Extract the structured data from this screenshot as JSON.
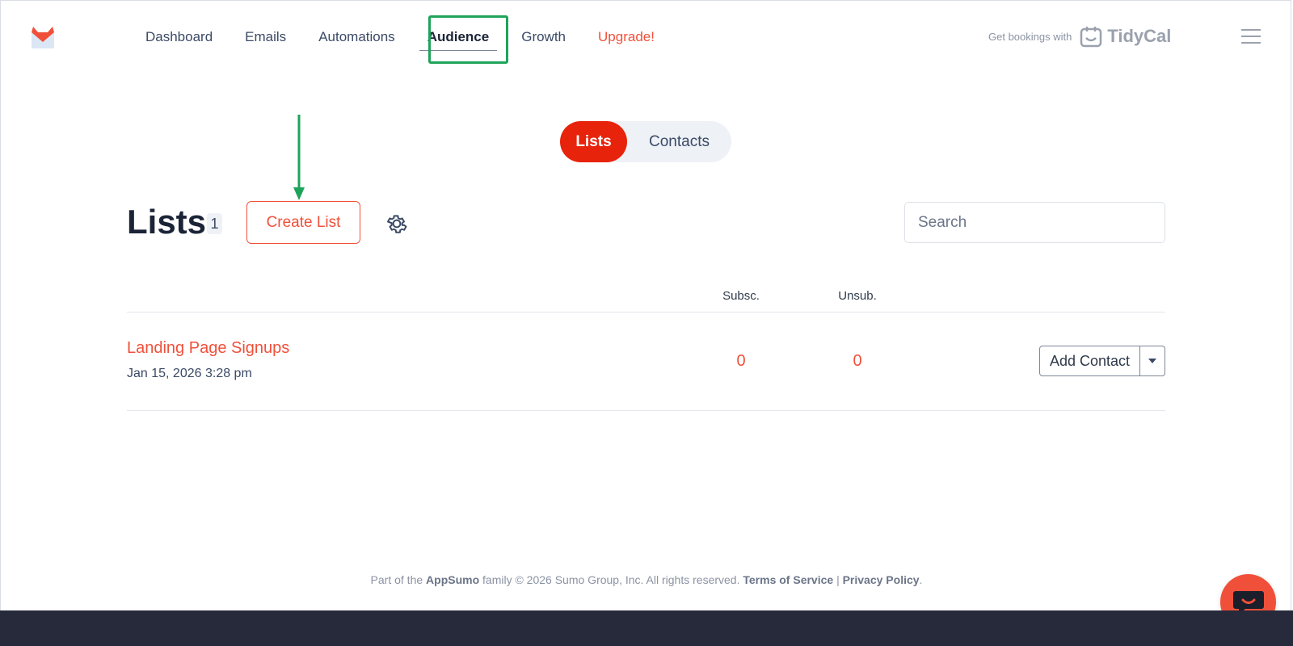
{
  "nav": {
    "items": [
      {
        "label": "Dashboard"
      },
      {
        "label": "Emails"
      },
      {
        "label": "Automations"
      },
      {
        "label": "Audience"
      },
      {
        "label": "Growth"
      },
      {
        "label": "Upgrade!"
      }
    ]
  },
  "promo": {
    "text": "Get bookings with",
    "brand": "TidyCal"
  },
  "toggle": {
    "lists": "Lists",
    "contacts": "Contacts"
  },
  "lists_header": {
    "title": "Lists",
    "count": "1",
    "create_label": "Create List",
    "search_placeholder": "Search"
  },
  "table": {
    "headers": {
      "subsc": "Subsc.",
      "unsub": "Unsub."
    },
    "rows": [
      {
        "name": "Landing Page Signups",
        "date": "Jan 15, 2026 3:28 pm",
        "subsc": "0",
        "unsub": "0",
        "action": "Add Contact"
      }
    ]
  },
  "footer": {
    "part_of": "Part of the",
    "appsumo": "AppSumo",
    "rest": "family © 2026 Sumo Group, Inc. All rights reserved.",
    "terms": "Terms of Service",
    "sep": "|",
    "privacy": "Privacy Policy",
    "end": "."
  },
  "colors": {
    "accent": "#f0503a",
    "toggle_active": "#e8230b",
    "highlight_green": "#1fa35a",
    "bottom_bar": "#272a3b"
  },
  "icons": {
    "logo": "sendfox-logo-icon",
    "menu": "hamburger-menu-icon",
    "settings": "gear-icon",
    "dropdown": "caret-down-icon",
    "chat": "chat-bubble-icon",
    "calendar": "tidycal-calendar-icon"
  }
}
